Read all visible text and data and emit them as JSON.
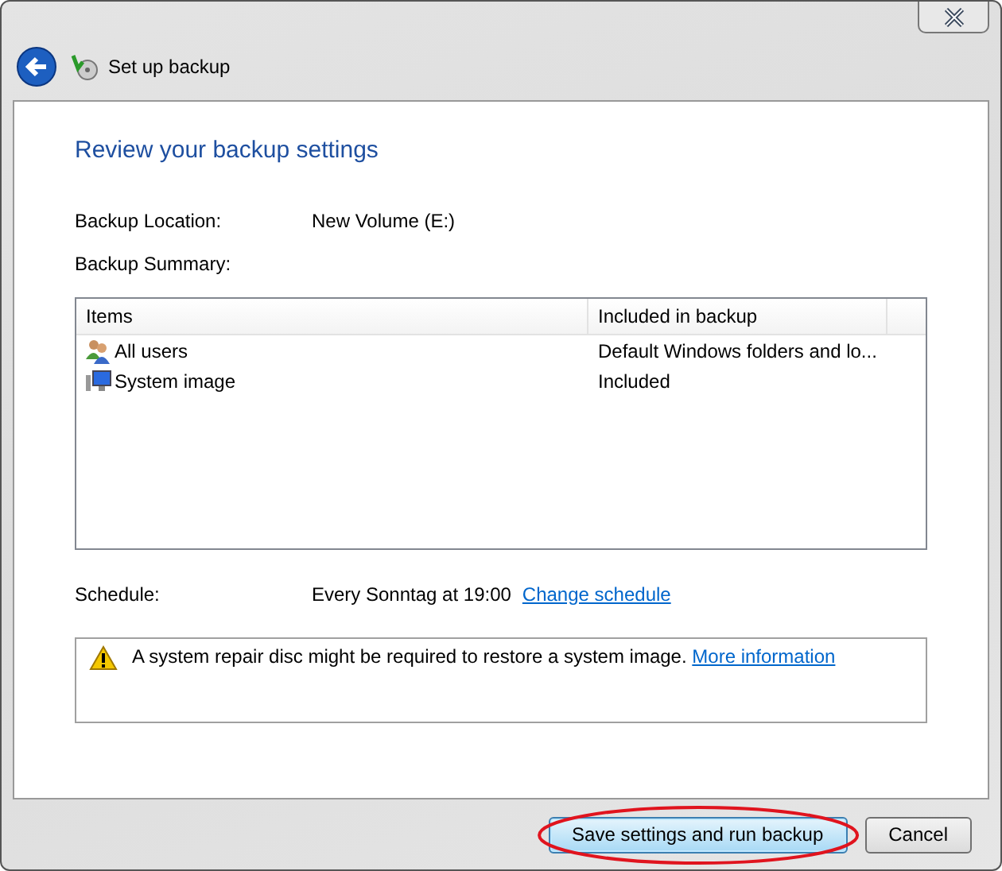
{
  "window": {
    "title": "Set up backup"
  },
  "heading": "Review your backup settings",
  "fields": [
    {
      "label": "Backup Location:",
      "value": "New Volume (E:)"
    },
    {
      "label": "Backup Summary:"
    }
  ],
  "table": {
    "columns": [
      "Items",
      "Included in backup"
    ],
    "rows": [
      {
        "kind": "users",
        "item": "All users",
        "included": "Default Windows folders and lo..."
      },
      {
        "kind": "system",
        "item": "System image",
        "included": "Included"
      }
    ]
  },
  "schedule": {
    "label": "Schedule:",
    "value": "Every Sonntag at 19:00",
    "link": "Change schedule"
  },
  "warning": {
    "text": "A system repair disc might be required to restore a system image.",
    "link": "More information"
  },
  "buttons": [
    {
      "label": "Save settings and run backup",
      "primary": true,
      "highlighted": true
    },
    {
      "label": "Cancel",
      "primary": false,
      "highlighted": false
    }
  ]
}
